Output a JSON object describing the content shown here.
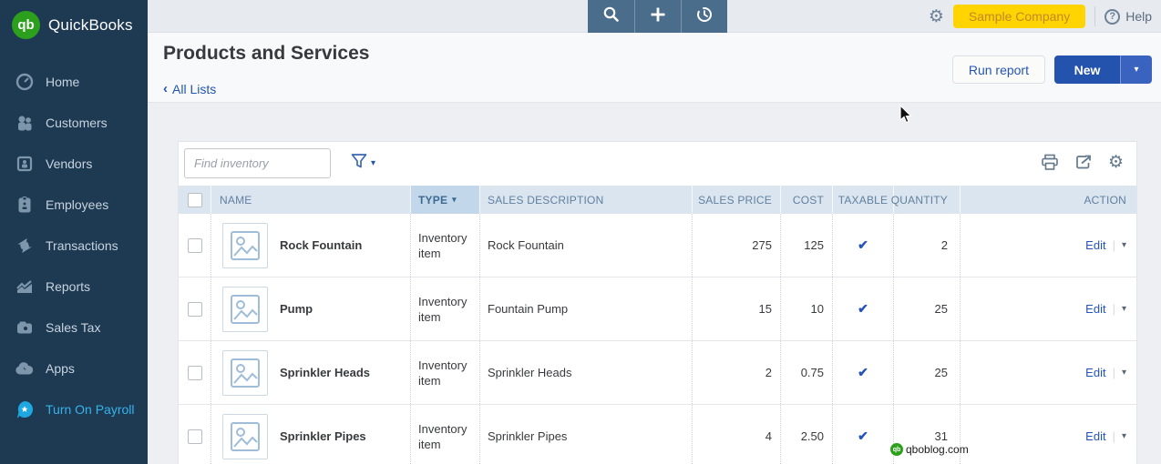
{
  "app": {
    "name": "QuickBooks",
    "logo_monogram": "qb"
  },
  "sidebar": {
    "items": [
      {
        "label": "Home",
        "icon": "speedometer-icon"
      },
      {
        "label": "Customers",
        "icon": "customers-icon"
      },
      {
        "label": "Vendors",
        "icon": "vendors-icon"
      },
      {
        "label": "Employees",
        "icon": "employees-icon"
      },
      {
        "label": "Transactions",
        "icon": "transactions-icon"
      },
      {
        "label": "Reports",
        "icon": "reports-icon"
      },
      {
        "label": "Sales Tax",
        "icon": "sales-tax-icon"
      },
      {
        "label": "Apps",
        "icon": "apps-icon"
      },
      {
        "label": "Turn On Payroll",
        "icon": "payroll-star-icon"
      }
    ]
  },
  "topbar": {
    "company_label": "Sample Company",
    "help_label": "Help",
    "help_glyph": "?"
  },
  "page": {
    "title": "Products and Services",
    "breadcrumb_label": "All Lists",
    "run_report_label": "Run report",
    "new_label": "New"
  },
  "toolbar": {
    "search_placeholder": "Find inventory"
  },
  "table": {
    "columns": [
      {
        "label": "NAME"
      },
      {
        "label": "TYPE",
        "sorted": true
      },
      {
        "label": "SALES DESCRIPTION"
      },
      {
        "label": "SALES PRICE"
      },
      {
        "label": "COST"
      },
      {
        "label": "TAXABLE"
      },
      {
        "label": "QUANTITY"
      },
      {
        "label": "ACTION"
      }
    ],
    "rows": [
      {
        "name": "Rock Fountain",
        "type": "Inventory item",
        "description": "Rock Fountain",
        "sales_price": "275",
        "cost": "125",
        "taxable": true,
        "quantity": "2",
        "action_label": "Edit"
      },
      {
        "name": "Pump",
        "type": "Inventory item",
        "description": "Fountain Pump",
        "sales_price": "15",
        "cost": "10",
        "taxable": true,
        "quantity": "25",
        "action_label": "Edit"
      },
      {
        "name": "Sprinkler Heads",
        "type": "Inventory item",
        "description": "Sprinkler Heads",
        "sales_price": "2",
        "cost": "0.75",
        "taxable": true,
        "quantity": "25",
        "action_label": "Edit"
      },
      {
        "name": "Sprinkler Pipes",
        "type": "Inventory item",
        "description": "Sprinkler Pipes",
        "sales_price": "4",
        "cost": "2.50",
        "taxable": true,
        "quantity": "31",
        "action_label": "Edit"
      }
    ]
  },
  "watermark": {
    "monogram": "qb",
    "text": "qboblog.com"
  },
  "icons": {
    "check": "✔",
    "caret_down": "▾",
    "chevron_left": "❮",
    "gear": "⚙"
  },
  "colors": {
    "sidebar_bg": "#1e3a53",
    "brand_green": "#2ca01c",
    "accent_blue": "#2453ad",
    "link_blue": "#2356b2",
    "company_yellow": "#ffd400",
    "header_row_bg": "#dbe5f0",
    "sorted_col_bg": "#c3d7ea"
  }
}
